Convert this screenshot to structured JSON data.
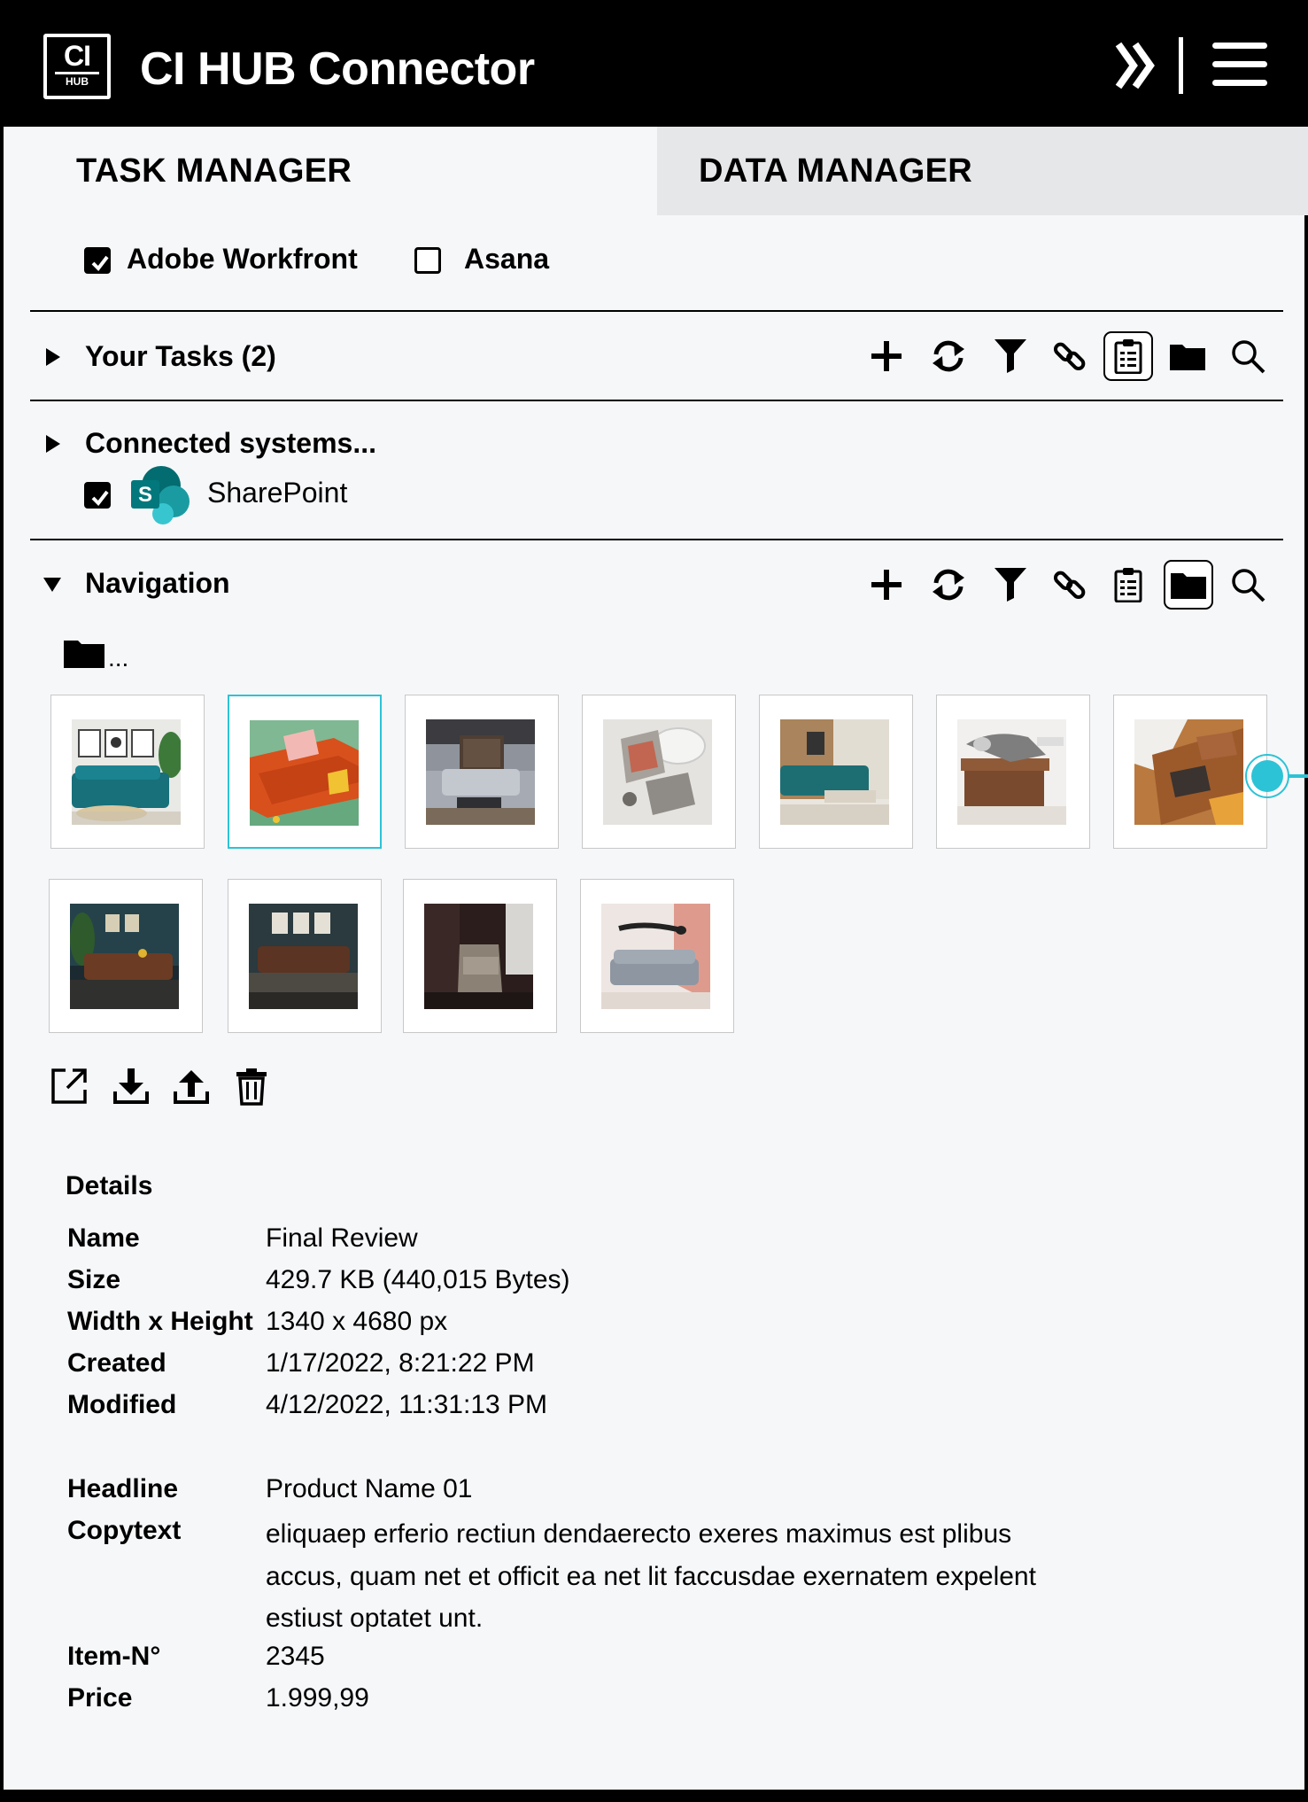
{
  "app": {
    "logo_main": "CI",
    "logo_sub": "HUB",
    "title": "CI HUB Connector"
  },
  "header_icons": [
    "double-chevron-right-icon",
    "hamburger-menu-icon"
  ],
  "tabs": [
    {
      "label": "TASK MANAGER",
      "active": true
    },
    {
      "label": "DATA MANAGER",
      "active": false
    }
  ],
  "task_sources": [
    {
      "label": "Adobe Workfront",
      "checked": true
    },
    {
      "label": "Asana",
      "checked": false
    }
  ],
  "your_tasks": {
    "title": "Your Tasks (2)",
    "expanded": false,
    "toolbar": [
      "plus-icon",
      "sync-icon",
      "filter-icon",
      "link-icon",
      "clipboard-icon",
      "folder-icon",
      "search-icon"
    ],
    "active_tool": "clipboard-icon"
  },
  "connected_systems": {
    "title": "Connected systems...",
    "expanded": false,
    "items": [
      {
        "label": "SharePoint",
        "logo_letter": "S",
        "checked": true
      }
    ]
  },
  "navigation": {
    "title": "Navigation",
    "expanded": true,
    "toolbar": [
      "plus-icon",
      "sync-icon",
      "filter-icon",
      "link-icon",
      "clipboard-icon",
      "folder-icon",
      "search-icon"
    ],
    "active_tool": "folder-icon",
    "folder_path": "...",
    "thumbnails": [
      {
        "subject": "teal sofa in living room",
        "selected": false
      },
      {
        "subject": "orange sofa with pink cushion",
        "selected": true
      },
      {
        "subject": "grey sofa under dark ceiling",
        "selected": false
      },
      {
        "subject": "room from above",
        "selected": false
      },
      {
        "subject": "teal sofa with wood wall",
        "selected": false
      },
      {
        "subject": "person lying on brown chair",
        "selected": false
      },
      {
        "subject": "brown leather sofa",
        "selected": false
      },
      {
        "subject": "leather sofa dark wall",
        "selected": false
      },
      {
        "subject": "brown sofa under framed pictures",
        "selected": false
      },
      {
        "subject": "armchair in dark room",
        "selected": false
      },
      {
        "subject": "person jumping over grey sofa",
        "selected": false
      }
    ],
    "actions": [
      "open-external-icon",
      "download-icon",
      "upload-icon",
      "trash-icon"
    ]
  },
  "details": {
    "title": "Details",
    "rows": [
      {
        "label": "Name",
        "value": "Final Review"
      },
      {
        "label": "Size",
        "value": "429.7 KB (440,015 Bytes)"
      },
      {
        "label": "Width x Height",
        "value": "1340 x 4680 px"
      },
      {
        "label": "Created",
        "value": "1/17/2022, 8:21:22 PM"
      },
      {
        "label": "Modified",
        "value": "4/12/2022, 11:31:13 PM"
      }
    ],
    "meta": [
      {
        "label": "Headline",
        "value": "Product Name 01"
      },
      {
        "label": "Copytext",
        "value": "eliquaep erferio rectiun dendaerecto exeres maximus est plibus accus, quam net et officit ea net lit faccusdae exernatem expelent estiust optatet unt."
      },
      {
        "label": "Item-N°",
        "value": "2345"
      },
      {
        "label": "Price",
        "value": "1.999,99"
      }
    ]
  },
  "colors": {
    "header_bg": "#000000",
    "panel_bg": "#f6f7f9",
    "inactive_tab_bg": "#e6e7e9",
    "accent": "#2cc3d6",
    "sharepoint_teal": "#1f8a8a"
  }
}
